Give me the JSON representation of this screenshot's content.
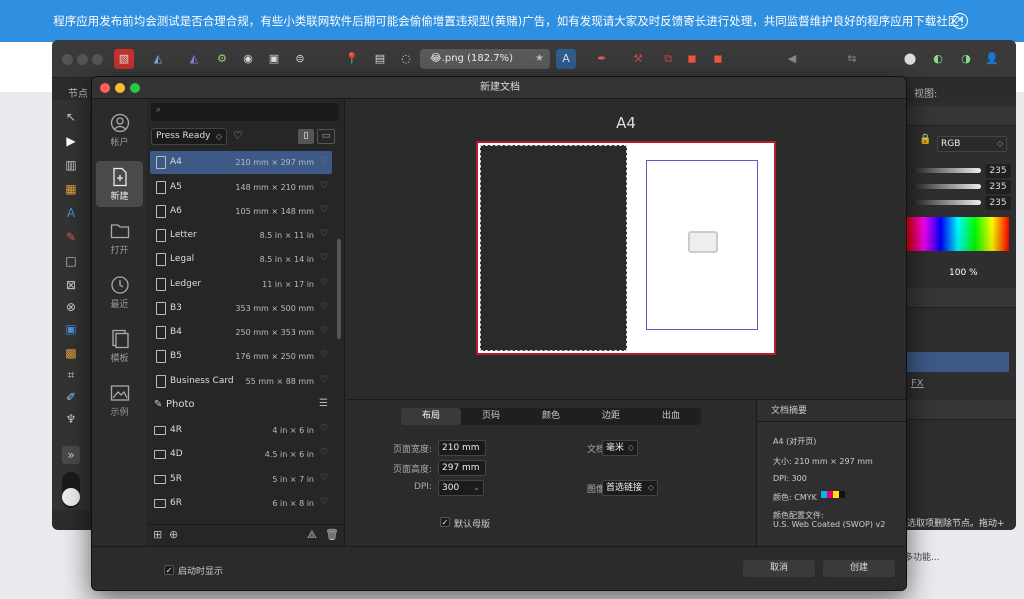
{
  "banner": {
    "text": "程序应用发布前均会测试是否合理合规，有些小类联网软件后期可能会偷偷增置违规型(黄赌)广告，如有发现请大家及时反馈寄长进行处理，共同监督维护良好的程序应用下载社区！"
  },
  "app": {
    "doc_tab": "😂.png (182.7%)",
    "context_label": "节点",
    "view_label": "视图:",
    "color_mode": "RGB",
    "sliders": [
      "235",
      "235",
      "235"
    ],
    "opacity": "100 %",
    "hint": "选取项删除节点。拖动+",
    "hint2": "多功能..."
  },
  "dialog": {
    "title": "新建文档",
    "nav": [
      {
        "label": "帐户",
        "icon": "account-icon"
      },
      {
        "label": "新建",
        "icon": "new-doc-icon"
      },
      {
        "label": "打开",
        "icon": "folder-icon"
      },
      {
        "label": "最近",
        "icon": "clock-icon"
      },
      {
        "label": "模板",
        "icon": "template-icon"
      },
      {
        "label": "示例",
        "icon": "samples-icon"
      }
    ],
    "preset_select": "Press Ready",
    "print_items": [
      {
        "name": "A4",
        "size": "210 mm × 297 mm"
      },
      {
        "name": "A5",
        "size": "148 mm × 210 mm"
      },
      {
        "name": "A6",
        "size": "105 mm × 148 mm"
      },
      {
        "name": "Letter",
        "size": "8.5 in × 11 in"
      },
      {
        "name": "Legal",
        "size": "8.5 in × 14 in"
      },
      {
        "name": "Ledger",
        "size": "11 in × 17 in"
      },
      {
        "name": "B3",
        "size": "353 mm × 500 mm"
      },
      {
        "name": "B4",
        "size": "250 mm × 353 mm"
      },
      {
        "name": "B5",
        "size": "176 mm × 250 mm"
      },
      {
        "name": "Business Card",
        "size": "55 mm × 88 mm"
      }
    ],
    "photo_category": "Photo",
    "photo_items": [
      {
        "name": "4R",
        "size": "4 in × 6 in"
      },
      {
        "name": "4D",
        "size": "4.5 in × 6 in"
      },
      {
        "name": "5R",
        "size": "5 in × 7 in"
      },
      {
        "name": "6R",
        "size": "6 in × 8 in"
      }
    ],
    "preview_title": "A4",
    "tabs": [
      "布局",
      "页码",
      "颜色",
      "边距",
      "出血"
    ],
    "fields": {
      "width_label": "页面宽度:",
      "width": "210 mm",
      "height_label": "页面高度:",
      "height": "297 mm",
      "dpi_label": "DPI:",
      "dpi": "300",
      "unit_label": "文档单元:",
      "unit": "毫米",
      "place_label": "图像放置:",
      "place": "首选链接",
      "master_label": "默认母版"
    },
    "summary": {
      "heading": "文档摘要",
      "name": "A4 (对开页)",
      "size": "大小: 210 mm × 297 mm",
      "dpi": "DPI: 300",
      "color": "颜色: CMYK",
      "profile_label": "颜色配置文件:",
      "profile": "U.S. Web Coated (SWOP) v2"
    },
    "show_on_start": "启动时显示",
    "cancel": "取消",
    "create": "创建"
  }
}
